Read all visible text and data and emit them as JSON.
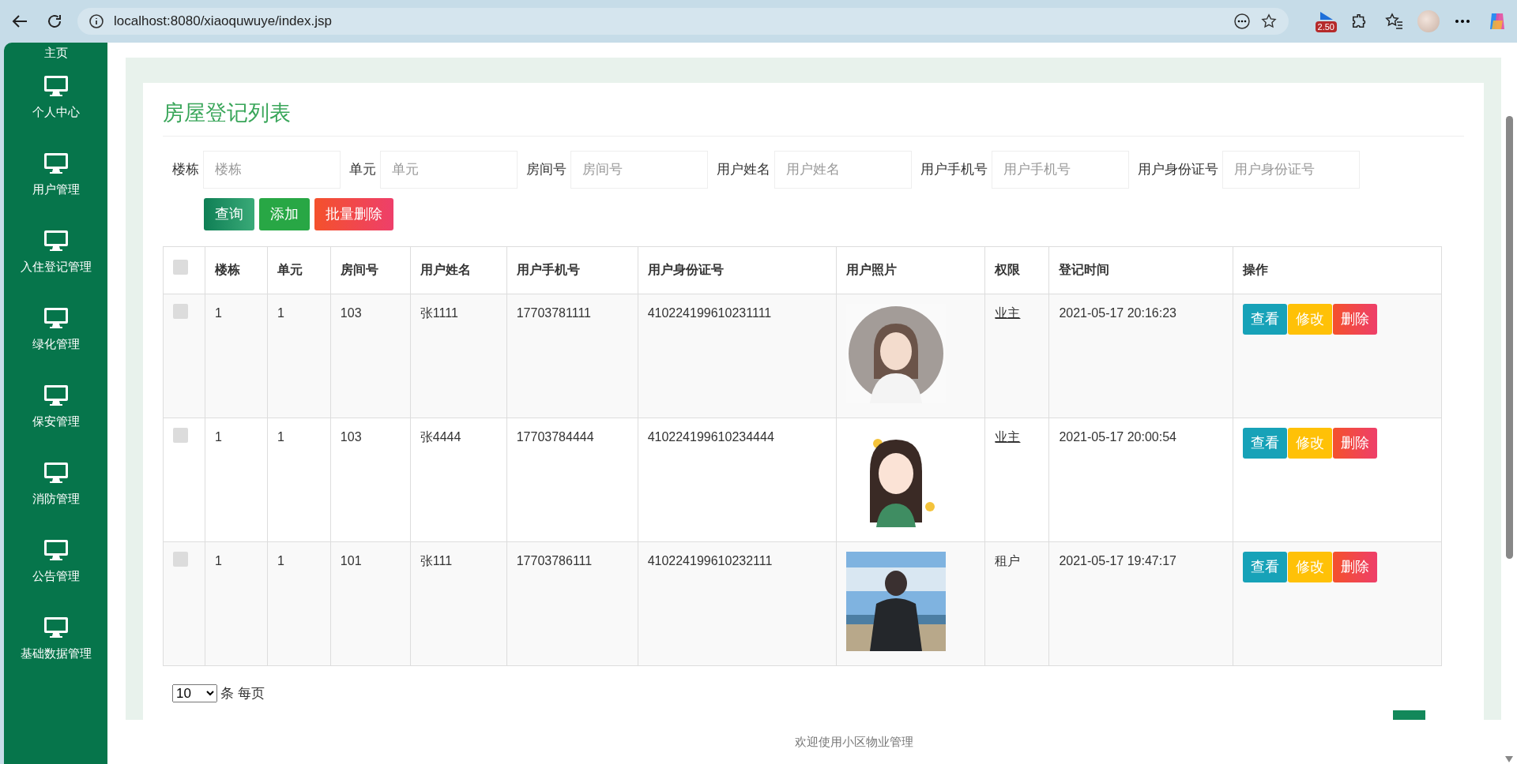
{
  "browser": {
    "url": "localhost:8080/xiaoquwuye/index.jsp",
    "extension_badge": "2.50"
  },
  "sidebar": {
    "items": [
      {
        "label": "主页",
        "icon": false
      },
      {
        "label": "个人中心",
        "icon": true
      },
      {
        "label": "用户管理",
        "icon": true
      },
      {
        "label": "入住登记管理",
        "icon": true
      },
      {
        "label": "绿化管理",
        "icon": true
      },
      {
        "label": "保安管理",
        "icon": true
      },
      {
        "label": "消防管理",
        "icon": true
      },
      {
        "label": "公告管理",
        "icon": true
      },
      {
        "label": "基础数据管理",
        "icon": true
      }
    ]
  },
  "page": {
    "title": "房屋登记列表"
  },
  "filters": [
    {
      "label": "楼栋",
      "placeholder": "楼栋"
    },
    {
      "label": "单元",
      "placeholder": "单元"
    },
    {
      "label": "房间号",
      "placeholder": "房间号"
    },
    {
      "label": "用户姓名",
      "placeholder": "用户姓名"
    },
    {
      "label": "用户手机号",
      "placeholder": "用户手机号"
    },
    {
      "label": "用户身份证号",
      "placeholder": "用户身份证号"
    }
  ],
  "actions": [
    {
      "label": "查询",
      "kind": "search"
    },
    {
      "label": "添加",
      "kind": "add"
    },
    {
      "label": "批量删除",
      "kind": "delete"
    }
  ],
  "table": {
    "select_all_checked": false,
    "columns": [
      "楼栋",
      "单元",
      "房间号",
      "用户姓名",
      "用户手机号",
      "用户身份证号",
      "用户照片",
      "权限",
      "登记时间",
      "操作"
    ],
    "rows": [
      {
        "checked": false,
        "building": "1",
        "unit": "1",
        "room": "103",
        "name": "张1111",
        "phone": "17703781111",
        "id_number": "410224199610231111",
        "role": "业主",
        "role_underlined": true,
        "time": "2021-05-17 20:16:23",
        "buttons": [
          {
            "label": "查看",
            "kind": "view"
          },
          {
            "label": "修改",
            "kind": "edit"
          },
          {
            "label": "删除",
            "kind": "delete"
          }
        ]
      },
      {
        "checked": false,
        "building": "1",
        "unit": "1",
        "room": "103",
        "name": "张4444",
        "phone": "17703784444",
        "id_number": "410224199610234444",
        "role": "业主",
        "role_underlined": true,
        "time": "2021-05-17 20:00:54",
        "buttons": [
          {
            "label": "查看",
            "kind": "view"
          },
          {
            "label": "修改",
            "kind": "edit"
          },
          {
            "label": "删除",
            "kind": "delete"
          }
        ]
      },
      {
        "checked": false,
        "building": "1",
        "unit": "1",
        "room": "101",
        "name": "张111",
        "phone": "17703786111",
        "id_number": "410224199610232111",
        "role": "租户",
        "role_underlined": false,
        "time": "2021-05-17 19:47:17",
        "buttons": [
          {
            "label": "查看",
            "kind": "view"
          },
          {
            "label": "修改",
            "kind": "edit"
          },
          {
            "label": "删除",
            "kind": "delete"
          }
        ]
      }
    ]
  },
  "pagination": {
    "page_size": "10",
    "suffix": "条 每页"
  },
  "footer": "欢迎使用小区物业管理"
}
